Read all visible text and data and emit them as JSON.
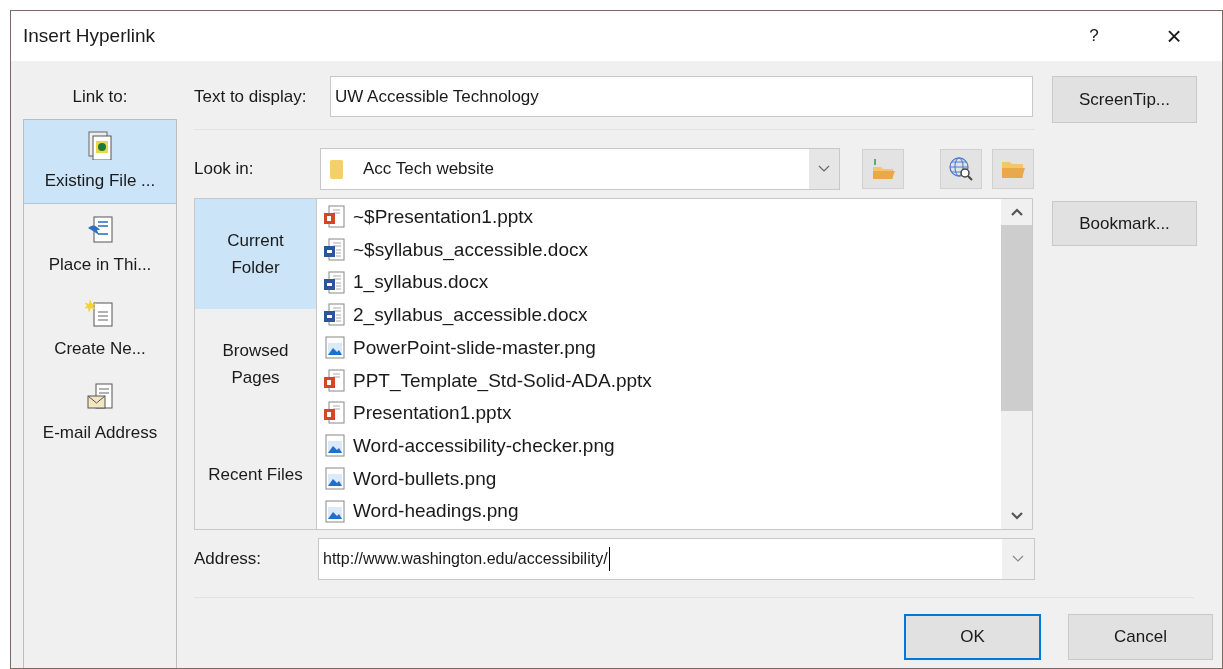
{
  "window": {
    "title": "Insert Hyperlink",
    "help": "?",
    "close": "×"
  },
  "link_to": {
    "label": "Link to:",
    "items": [
      {
        "label": "Existing File ...",
        "kind": "file",
        "selected": true
      },
      {
        "label": "Place in Thi...",
        "kind": "place",
        "selected": false
      },
      {
        "label": "Create Ne...",
        "kind": "new",
        "selected": false
      },
      {
        "label": "E-mail Address",
        "kind": "email",
        "selected": false
      }
    ]
  },
  "text_to_display": {
    "label": "Text to display:",
    "value": "UW Accessible Technology"
  },
  "look_in": {
    "label": "Look in:",
    "value": "Acc Tech website"
  },
  "browse_tabs": [
    {
      "label": "Current Folder",
      "selected": true
    },
    {
      "label": "Browsed Pages",
      "selected": false
    },
    {
      "label": "Recent Files",
      "selected": false
    }
  ],
  "files": [
    {
      "name": "~$Presentation1.pptx",
      "kind": "pptx"
    },
    {
      "name": "~$syllabus_accessible.docx",
      "kind": "docx"
    },
    {
      "name": "1_syllabus.docx",
      "kind": "docx"
    },
    {
      "name": "2_syllabus_accessible.docx",
      "kind": "docx"
    },
    {
      "name": "PowerPoint-slide-master.png",
      "kind": "png"
    },
    {
      "name": "PPT_Template_Std-Solid-ADA.pptx",
      "kind": "pptx"
    },
    {
      "name": "Presentation1.pptx",
      "kind": "pptx"
    },
    {
      "name": "Word-accessibility-checker.png",
      "kind": "png"
    },
    {
      "name": "Word-bullets.png",
      "kind": "png"
    },
    {
      "name": "Word-headings.png",
      "kind": "png"
    }
  ],
  "address": {
    "label": "Address:",
    "value": "http://www.washington.edu/accessibility/"
  },
  "side_buttons": [
    "ScreenTip...",
    "Bookmark..."
  ],
  "buttons": [
    {
      "label": "OK",
      "default": true
    },
    {
      "label": "Cancel",
      "default": false
    }
  ]
}
